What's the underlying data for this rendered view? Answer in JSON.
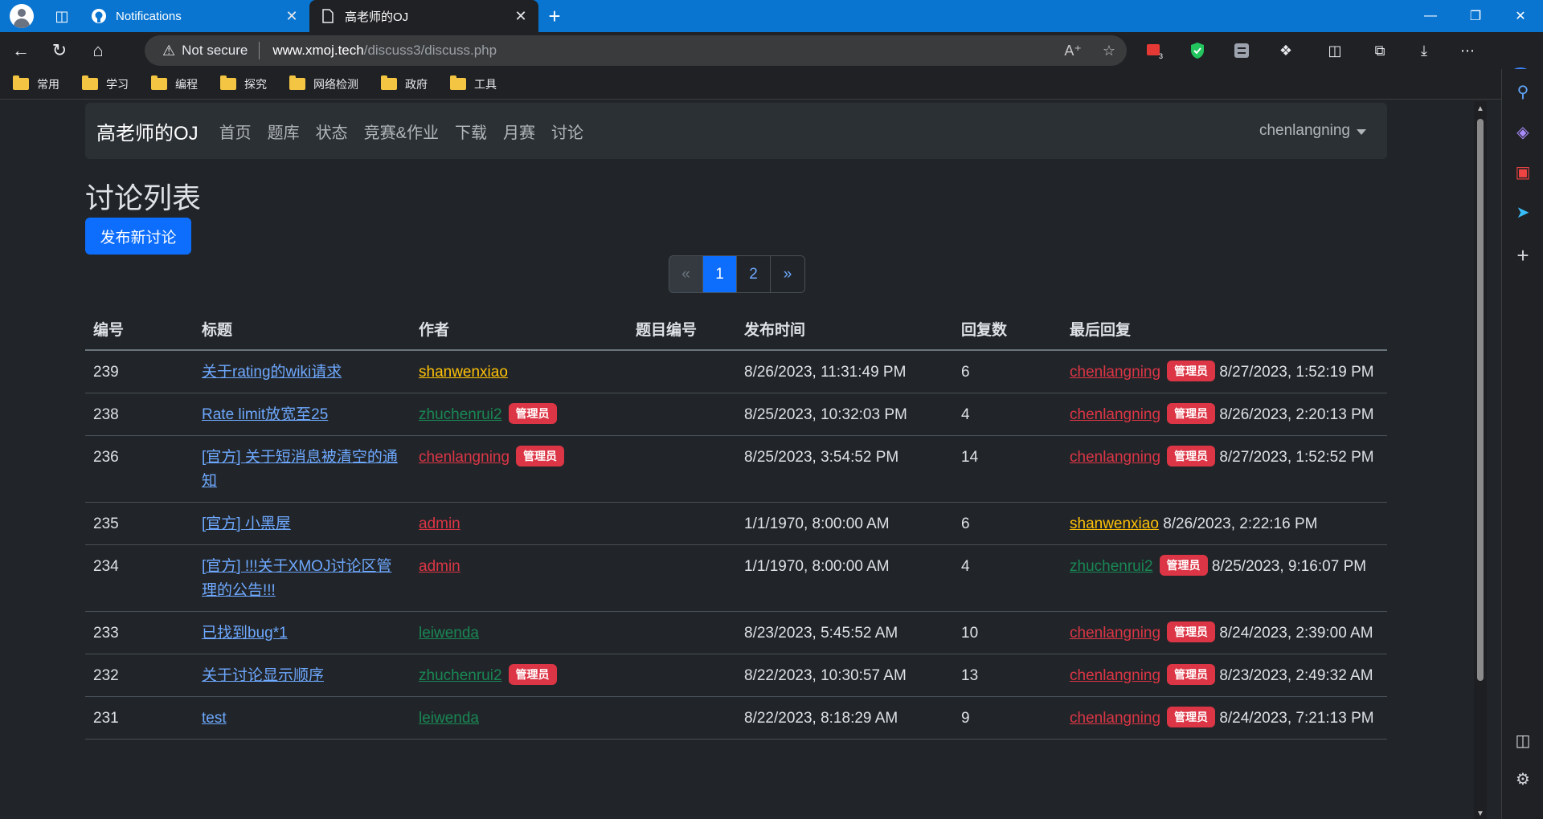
{
  "browser": {
    "tabs": [
      {
        "title": "Notifications",
        "icon": "github-icon"
      },
      {
        "title": "高老师的OJ",
        "icon": "page-icon"
      }
    ],
    "address": {
      "security": "Not secure",
      "host": "www.xmoj.tech",
      "path": "/discuss3/discuss.php"
    },
    "extension_badge": "3",
    "bookmarks": [
      "常用",
      "学习",
      "编程",
      "探究",
      "网络检测",
      "政府",
      "工具"
    ],
    "colors": {
      "titlebar": "#0a75d1",
      "chrome": "#202124"
    }
  },
  "site": {
    "brand": "高老师的OJ",
    "nav": [
      "首页",
      "题库",
      "状态",
      "竞赛&作业",
      "下载",
      "月赛",
      "讨论"
    ],
    "user": "chenlangning"
  },
  "page": {
    "title": "讨论列表",
    "new_post": "发布新讨论",
    "pager": {
      "prev": "«",
      "pages": [
        "1",
        "2"
      ],
      "current": "1",
      "next": "»"
    },
    "columns": [
      "编号",
      "标题",
      "作者",
      "题目编号",
      "发布时间",
      "回复数",
      "最后回复"
    ],
    "admin_badge": "管理员",
    "rows": [
      {
        "id": "239",
        "title": "关于rating的wiki请求",
        "author": "shanwenxiao",
        "author_color": "orange",
        "author_admin": false,
        "problem": "",
        "time": "8/26/2023, 11:31:49 PM",
        "replies": "6",
        "last_user": "chenlangning",
        "last_color": "red",
        "last_admin": true,
        "last_time": "8/27/2023, 1:52:19 PM"
      },
      {
        "id": "238",
        "title": "Rate limit放宽至25",
        "author": "zhuchenrui2",
        "author_color": "green",
        "author_admin": true,
        "problem": "",
        "time": "8/25/2023, 10:32:03 PM",
        "replies": "4",
        "last_user": "chenlangning",
        "last_color": "red",
        "last_admin": true,
        "last_time": "8/26/2023, 2:20:13 PM"
      },
      {
        "id": "236",
        "title": "[官方] 关于短消息被清空的通知",
        "author": "chenlangning",
        "author_color": "red",
        "author_admin": true,
        "problem": "",
        "time": "8/25/2023, 3:54:52 PM",
        "replies": "14",
        "last_user": "chenlangning",
        "last_color": "red",
        "last_admin": true,
        "last_time": "8/27/2023, 1:52:52 PM"
      },
      {
        "id": "235",
        "title": "[官方] 小黑屋",
        "author": "admin",
        "author_color": "red",
        "author_admin": false,
        "problem": "",
        "time": "1/1/1970, 8:00:00 AM",
        "replies": "6",
        "last_user": "shanwenxiao",
        "last_color": "orange",
        "last_admin": false,
        "last_time": "8/26/2023, 2:22:16 PM"
      },
      {
        "id": "234",
        "title": "[官方] !!!关于XMOJ讨论区管理的公告!!!",
        "author": "admin",
        "author_color": "red",
        "author_admin": false,
        "problem": "",
        "time": "1/1/1970, 8:00:00 AM",
        "replies": "4",
        "last_user": "zhuchenrui2",
        "last_color": "green",
        "last_admin": true,
        "last_time": "8/25/2023, 9:16:07 PM"
      },
      {
        "id": "233",
        "title": "已找到bug*1",
        "author": "leiwenda",
        "author_color": "green",
        "author_admin": false,
        "problem": "",
        "time": "8/23/2023, 5:45:52 AM",
        "replies": "10",
        "last_user": "chenlangning",
        "last_color": "red",
        "last_admin": true,
        "last_time": "8/24/2023, 2:39:00 AM"
      },
      {
        "id": "232",
        "title": "关于讨论显示顺序",
        "author": "zhuchenrui2",
        "author_color": "green",
        "author_admin": true,
        "problem": "",
        "time": "8/22/2023, 10:30:57 AM",
        "replies": "13",
        "last_user": "chenlangning",
        "last_color": "red",
        "last_admin": true,
        "last_time": "8/23/2023, 2:49:32 AM"
      },
      {
        "id": "231",
        "title": "test",
        "author": "leiwenda",
        "author_color": "green",
        "author_admin": false,
        "problem": "",
        "time": "8/22/2023, 8:18:29 AM",
        "replies": "9",
        "last_user": "chenlangning",
        "last_color": "red",
        "last_admin": true,
        "last_time": "8/24/2023, 7:21:13 PM"
      }
    ]
  }
}
